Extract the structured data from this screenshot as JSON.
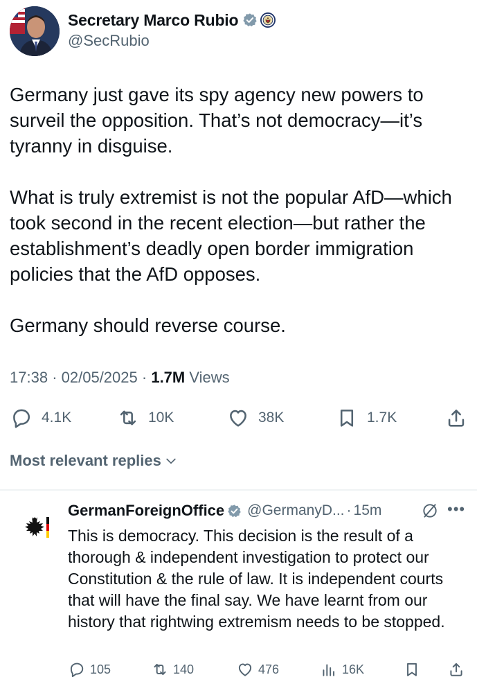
{
  "tweet": {
    "author_name": "Secretary Marco Rubio",
    "author_handle": "@SecRubio",
    "paragraphs": [
      "Germany just gave its spy agency new powers to surveil the opposition.  That’s not democracy—it’s tyranny in disguise.",
      "What is truly extremist is not the popular AfD—which took second in the recent election—but rather the establishment’s deadly open border immigration policies that the AfD opposes.",
      "Germany should reverse course."
    ],
    "time": "17:38",
    "date": "02/05/2025",
    "views_count": "1.7M",
    "views_label": "Views",
    "replies": "4.1K",
    "reposts": "10K",
    "likes": "38K",
    "bookmarks": "1.7K"
  },
  "replies_sort_label": "Most relevant replies",
  "reply": {
    "author_name": "GermanForeignOffice",
    "author_handle": "@GermanyD...",
    "time": "15m",
    "text": "This is democracy. This decision is the result of a thorough & independent investigation to protect our Constitution & the rule of law. It is independent courts that will have the final say. We have learnt from our history that rightwing extremism needs to be stopped.",
    "replies": "105",
    "reposts": "140",
    "likes": "476",
    "views": "16K"
  },
  "icons": {
    "verified": "verified-badge-icon",
    "seal": "state-department-seal-icon",
    "reply": "reply-bubble-icon",
    "repost": "repost-icon",
    "like": "heart-icon",
    "bookmark": "bookmark-icon",
    "share": "share-icon",
    "views": "views-bar-chart-icon",
    "grok": "grok-icon",
    "more": "more-options-icon",
    "chevron": "chevron-down-icon",
    "eagle": "german-eagle-logo-icon"
  },
  "colors": {
    "text": "#0f1419",
    "secondary": "#536471",
    "verified": "#829aab",
    "divider": "#eff3f4"
  }
}
